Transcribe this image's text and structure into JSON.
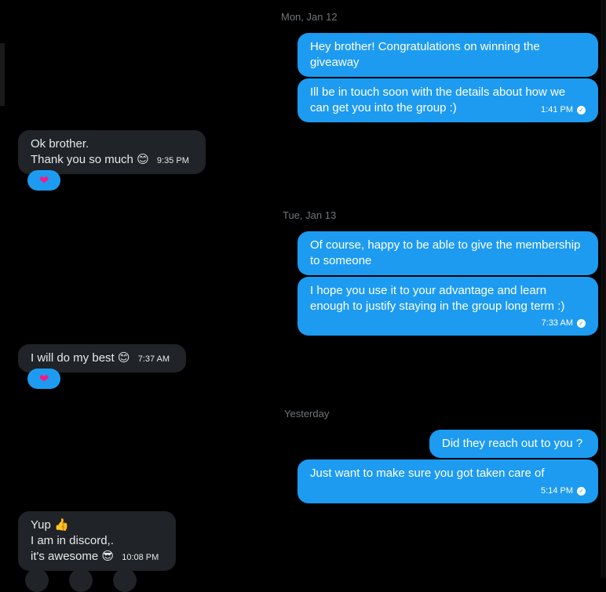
{
  "dates": {
    "d1": "Mon, Jan 12",
    "d2": "Tue, Jan 13",
    "d3": "Yesterday"
  },
  "messages": [
    {
      "text": "Hey brother! Congratulations on winning the giveaway"
    },
    {
      "text_line1": "Ill be in touch soon with the details about how we",
      "text_line2": "can get you into the group :)",
      "time": "1:41 PM"
    },
    {
      "line1": "Ok brother.",
      "line2": "Thank you so much",
      "emoji": "😊",
      "time": "9:35 PM",
      "reaction": "❤"
    },
    {
      "text": "Of course, happy to be able to give the membership to someone"
    },
    {
      "text_line1": "I hope you use it to your advantage and learn",
      "text_line2": "enough to justify staying in the group long term :)",
      "time": "7:33 AM"
    },
    {
      "text": "I will do my best",
      "emoji": "😊",
      "time": "7:37 AM",
      "reaction": "❤"
    },
    {
      "text": "Did they reach out to you ?"
    },
    {
      "text": "Just want to make sure you got taken care of",
      "time": "5:14 PM"
    },
    {
      "line1": "Yup",
      "emoji1": "👍",
      "line2": "I am in discord,.",
      "line3": "it's awesome",
      "emoji3": "😎",
      "time": "10:08 PM"
    }
  ],
  "icons": {
    "check": "check-circle-icon",
    "heart": "heart-icon"
  },
  "colors": {
    "sent_bubble": "#1d9bf0",
    "received_bubble": "#202327",
    "background": "#000000",
    "timestamp": "#71767b"
  }
}
